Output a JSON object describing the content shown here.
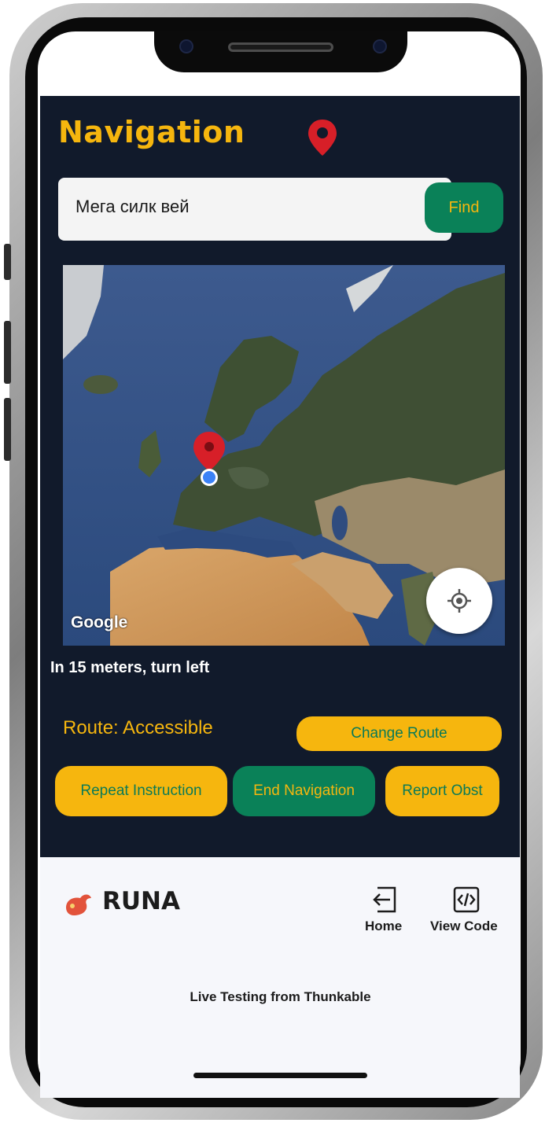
{
  "app": {
    "title": "Navigation",
    "search": {
      "value": "Мега силк вей",
      "find_label": "Find"
    },
    "map": {
      "attribution": "Google"
    },
    "instruction": "In 15 meters, turn left",
    "route_label": "Route: Accessible",
    "buttons": {
      "change_route": "Change Route",
      "repeat_instruction": "Repeat Instruction",
      "end_navigation": "End Navigation",
      "report_obstacle": "Report Obst"
    }
  },
  "thunkable_bar": {
    "app_name": "RUNA",
    "home_label": "Home",
    "view_code_label": "View Code",
    "footer": "Live Testing from Thunkable"
  },
  "colors": {
    "accent_yellow": "#f6b60e",
    "accent_green": "#0a8158",
    "background_dark": "#111a2b"
  },
  "icons": [
    "map-pin-icon",
    "my-location-icon",
    "runa-logo-icon",
    "home-exit-icon",
    "code-icon"
  ]
}
